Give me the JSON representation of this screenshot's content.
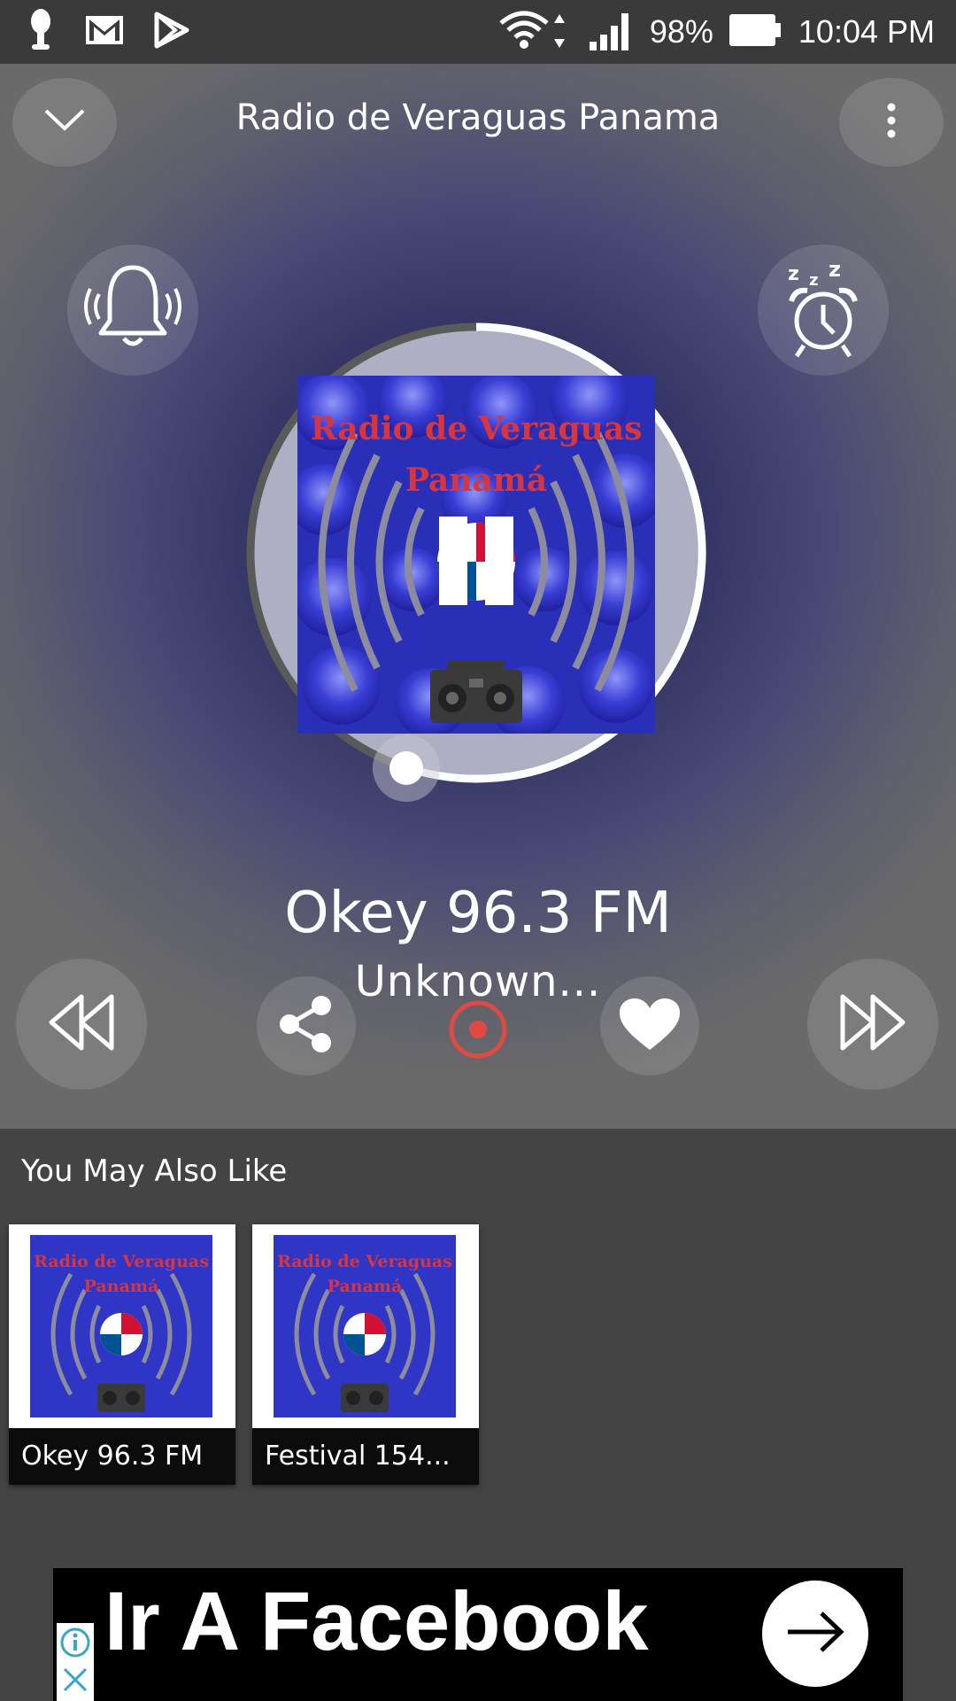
{
  "status_bar": {
    "battery": "98%",
    "time": "10:04 PM",
    "icons": [
      "mic-icon",
      "gmail-icon",
      "play-store-icon",
      "wifi-icon",
      "signal-icon",
      "battery-icon"
    ]
  },
  "header": {
    "title": "Radio de Veraguas Panama",
    "collapse_icon": "chevron-down-icon",
    "menu_icon": "more-vertical-icon"
  },
  "player": {
    "station_name": "Okey 96.3 FM",
    "track": "Unknown...",
    "artwork_text_line1": "Radio de Veraguas",
    "artwork_text_line2": "Panamá",
    "progress": 0.55,
    "state": "playing"
  },
  "controls": [
    "alarm-bell-icon",
    "sleep-timer-icon",
    "rewind-icon",
    "share-icon",
    "record-icon",
    "heart-icon",
    "fast-forward-icon"
  ],
  "recommendations": {
    "title": "You May Also Like",
    "items": [
      {
        "label": "Okey 96.3 FM"
      },
      {
        "label": "Festival 154..."
      }
    ]
  },
  "ad": {
    "text": "Ir A Facebook"
  },
  "colors": {
    "accent_record": "#e04a42",
    "background": "#444444",
    "status_bar": "#3a3a3a"
  }
}
